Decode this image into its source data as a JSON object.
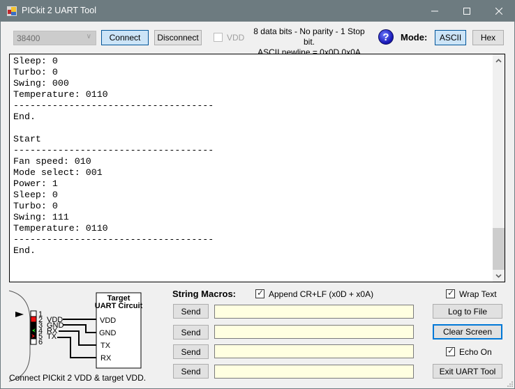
{
  "window": {
    "title": "PICkit 2 UART Tool",
    "controls": {
      "minimize": "—",
      "maximize": "☐",
      "close": "✕"
    }
  },
  "toolbar": {
    "baud_rate": "38400",
    "connect_label": "Connect",
    "disconnect_label": "Disconnect",
    "vdd_label": "VDD",
    "vdd_checked": false,
    "info_line1": "8 data bits - No parity - 1 Stop bit.",
    "info_line2": "ASCII newline = 0x0D 0x0A",
    "help_icon": "?",
    "mode_label": "Mode:",
    "ascii_label": "ASCII",
    "hex_label": "Hex",
    "active_mode": "ASCII"
  },
  "terminal": {
    "lines": [
      "Sleep: 0",
      "Turbo: 0",
      "Swing: 000",
      "Temperature: 0110",
      "------------------------------------",
      "End.",
      "",
      "Start",
      "------------------------------------",
      "Fan speed: 010",
      "Mode select: 001",
      "Power: 1",
      "Sleep: 0",
      "Turbo: 0",
      "Swing: 111",
      "Temperature: 0110",
      "------------------------------------",
      "End."
    ],
    "scroll_position": 0.92
  },
  "diagram": {
    "pins": [
      "1",
      "2",
      "3",
      "4",
      "5",
      "6"
    ],
    "pin_labels": [
      "",
      "VDD",
      "GND",
      "RX",
      "TX",
      ""
    ],
    "target_title_line1": "Target",
    "target_title_line2": "UART Circuit",
    "target_pins": [
      "VDD",
      "GND",
      "TX",
      "RX"
    ],
    "note": "Connect PICkit 2 VDD & target VDD."
  },
  "macros": {
    "title": "String Macros:",
    "append_label": "Append CR+LF (x0D + x0A)",
    "append_checked": true,
    "send_label": "Send",
    "rows": [
      {
        "value": ""
      },
      {
        "value": ""
      },
      {
        "value": ""
      },
      {
        "value": ""
      }
    ]
  },
  "side": {
    "wrap_label": "Wrap Text",
    "wrap_checked": true,
    "log_label": "Log to File",
    "clear_label": "Clear Screen",
    "echo_label": "Echo On",
    "echo_checked": true,
    "exit_label": "Exit UART Tool"
  },
  "colors": {
    "titlebar": "#6d7b80",
    "client_bg": "#f0f0f0",
    "macro_field_bg": "#ffffe1",
    "active_button_bg": "#cce4f7",
    "focus_border": "#0078d7"
  }
}
